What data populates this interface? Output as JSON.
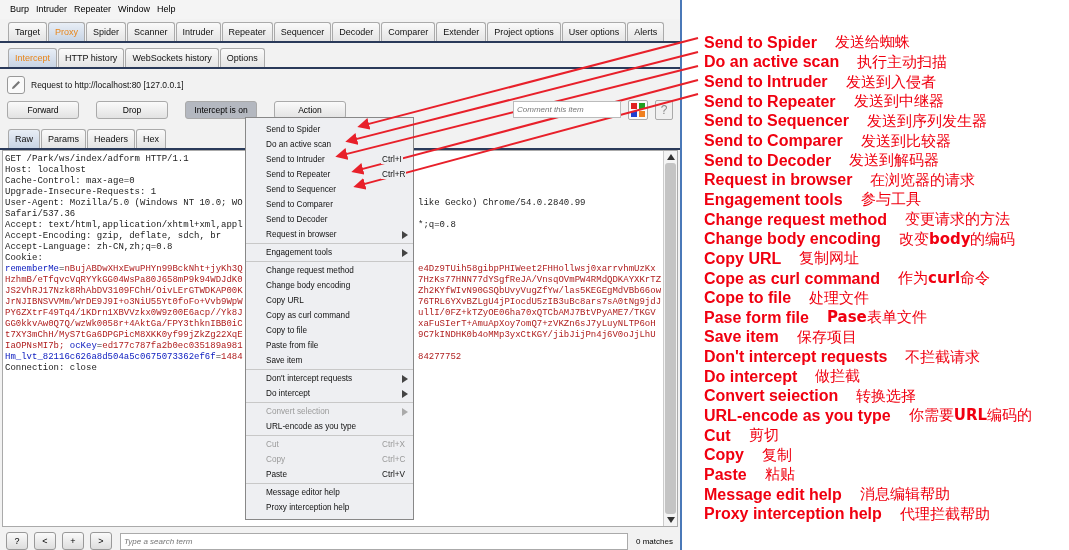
{
  "menu_bar": [
    "Burp",
    "Intruder",
    "Repeater",
    "Window",
    "Help"
  ],
  "tabs": [
    {
      "label": "Target",
      "selected": false
    },
    {
      "label": "Proxy",
      "selected": true
    },
    {
      "label": "Spider",
      "selected": false
    },
    {
      "label": "Scanner",
      "selected": false
    },
    {
      "label": "Intruder",
      "selected": false
    },
    {
      "label": "Repeater",
      "selected": false
    },
    {
      "label": "Sequencer",
      "selected": false
    },
    {
      "label": "Decoder",
      "selected": false
    },
    {
      "label": "Comparer",
      "selected": false
    },
    {
      "label": "Extender",
      "selected": false
    },
    {
      "label": "Project options",
      "selected": false
    },
    {
      "label": "User options",
      "selected": false
    },
    {
      "label": "Alerts",
      "selected": false
    }
  ],
  "sub_tabs": [
    {
      "label": "Intercept",
      "selected": true
    },
    {
      "label": "HTTP history",
      "selected": false
    },
    {
      "label": "WebSockets history",
      "selected": false
    },
    {
      "label": "Options",
      "selected": false
    }
  ],
  "request_info": "Request to http://localhost:80  [127.0.0.1]",
  "buttons": [
    {
      "label": "Forward",
      "pressed": false
    },
    {
      "label": "Drop",
      "pressed": false
    },
    {
      "label": "Intercept is on",
      "pressed": true
    },
    {
      "label": "Action",
      "pressed": false
    }
  ],
  "comment": {
    "placeholder": "Comment this item"
  },
  "help_button": "?",
  "editor_tabs": [
    {
      "label": "Raw",
      "selected": true
    },
    {
      "label": "Params",
      "selected": false
    },
    {
      "label": "Headers",
      "selected": false
    },
    {
      "label": "Hex",
      "selected": false
    }
  ],
  "request_lines": [
    {
      "left": [
        {
          "text": "GET /Park/ws/index/adform HTTP/1.1",
          "kind": "plain"
        }
      ]
    },
    {
      "left": [
        {
          "text": "Host: localhost",
          "kind": "plain"
        }
      ]
    },
    {
      "left": [
        {
          "text": "Cache-Control: max-age=0",
          "kind": "plain"
        }
      ]
    },
    {
      "left": [
        {
          "text": "Upgrade-Insecure-Requests: 1",
          "kind": "plain"
        }
      ]
    },
    {
      "left": [
        {
          "text": "User-Agent: Mozilla/5.0 (Windows NT 10.0; WO",
          "kind": "plain"
        }
      ],
      "right": [
        {
          "text": "like Gecko) Chrome/54.0.2840.99",
          "kind": "plain"
        }
      ]
    },
    {
      "left": [
        {
          "text": "Safari/537.36",
          "kind": "plain"
        }
      ]
    },
    {
      "left": [
        {
          "text": "Accept: text/html,application/xhtml+xml,appl",
          "kind": "plain"
        }
      ],
      "right": [
        {
          "text": "*;q=0.8",
          "kind": "plain"
        }
      ]
    },
    {
      "left": [
        {
          "text": "Accept-Encoding: gzip, deflate, sdch, br",
          "kind": "plain"
        }
      ]
    },
    {
      "left": [
        {
          "text": "Accept-Language: zh-CN,zh;q=0.8",
          "kind": "plain"
        }
      ]
    },
    {
      "left": [
        {
          "text": "Cookie:",
          "kind": "plain"
        }
      ]
    },
    {
      "left": [
        {
          "text": "rememberMe",
          "kind": "name"
        },
        {
          "text": "=",
          "kind": "plain"
        },
        {
          "text": "nBujABDwXHxEwuPHYn99BckNht+jyKh3Q",
          "kind": "value"
        }
      ],
      "right": [
        {
          "text": "e4Dz9TUih58gibpPHIWeet2FHHollwsj0xarrvhmUzKx",
          "kind": "value"
        }
      ]
    },
    {
      "left": [
        {
          "text": "HzhmB/eTfqvcVqRYYkGG04WsPa80J658mP9k94WDJdK0",
          "kind": "value"
        }
      ],
      "right": [
        {
          "text": "7HzKs77HNN77dYSgfReJA/VnsqOVmPW4RMdQDKAYXKrTZ",
          "kind": "value"
        }
      ]
    },
    {
      "left": [
        {
          "text": "JS2VhRJ17Nzk8RhAbDV3109FChH/OivLErGTWDKAP00K",
          "kind": "value"
        }
      ],
      "right": [
        {
          "text": "Zh2KYfWIvN90GSQbUvyVugZfYw/las5KEGEgMdVBb66ow",
          "kind": "value"
        }
      ]
    },
    {
      "left": [
        {
          "text": "JrNJIBNSVVMm/WrDE9J9I+o3NiU55Yt0foFo+Vvb9WpW",
          "kind": "value"
        }
      ],
      "right": [
        {
          "text": "76TRL6YXvBZLgU4jPIocdU5zIB3uBc8ars7sA0tNg9jdJ",
          "kind": "value"
        }
      ]
    },
    {
      "left": [
        {
          "text": "PY6ZXtrF49Tq4/1KDrn1XBVVzkx0W9z00E6acp//Yk8J",
          "kind": "value"
        }
      ],
      "right": [
        {
          "text": "ullI/0FZ+kTZyOE06ha70xQTCbAMJ7BtVPyAME7/TKGV",
          "kind": "value"
        }
      ]
    },
    {
      "left": [
        {
          "text": "GG0kkvAw0Q7Q/wzWk0058r+4AktGa/FPY3thknIBB0iC",
          "kind": "value"
        }
      ],
      "right": [
        {
          "text": "xaFuSIerT+AmuApXoy7omQ7+zVKZn6sJ7yLuyNLTP6oH",
          "kind": "value"
        }
      ]
    },
    {
      "left": [
        {
          "text": "t7XY3mChH/MyS7tGa6DPGPicM8XKK0yf99jZkZg22XqE",
          "kind": "value"
        }
      ],
      "right": [
        {
          "text": "9C7kINDHK0b4oMMp3yxCtKGY/jibJijPn4j6V0oJjLhU",
          "kind": "value"
        }
      ]
    },
    {
      "left": [
        {
          "text": "IaOPNsMI7b; ",
          "kind": "value"
        },
        {
          "text": "ocKey",
          "kind": "name"
        },
        {
          "text": "=",
          "kind": "plain"
        },
        {
          "text": "ed177c787fa2b0ec035189a981",
          "kind": "value"
        }
      ]
    },
    {
      "left": [
        {
          "text": "Hm_lvt_82116c626a8d504a5c0675073362ef6f",
          "kind": "name"
        },
        {
          "text": "=",
          "kind": "plain"
        },
        {
          "text": "1484",
          "kind": "value"
        }
      ],
      "right": [
        {
          "text": "84277752",
          "kind": "value"
        }
      ]
    },
    {
      "left": [
        {
          "text": "Connection: close",
          "kind": "plain"
        }
      ]
    }
  ],
  "context_menu": [
    [
      {
        "label": "Send to Spider",
        "submenu": false,
        "disabled": false
      },
      {
        "label": "Do an active scan",
        "submenu": false,
        "disabled": false
      },
      {
        "label": "Send to Intruder",
        "shortcut": "Ctrl+I",
        "submenu": false,
        "disabled": false
      },
      {
        "label": "Send to Repeater",
        "shortcut": "Ctrl+R",
        "submenu": false,
        "disabled": false
      },
      {
        "label": "Send to Sequencer",
        "submenu": false,
        "disabled": false
      },
      {
        "label": "Send to Comparer",
        "submenu": false,
        "disabled": false
      },
      {
        "label": "Send to Decoder",
        "submenu": false,
        "disabled": false
      },
      {
        "label": "Request in browser",
        "submenu": true,
        "disabled": false
      }
    ],
    [
      {
        "label": "Engagement tools",
        "submenu": true,
        "disabled": false
      }
    ],
    [
      {
        "label": "Change request method",
        "submenu": false,
        "disabled": false
      },
      {
        "label": "Change body encoding",
        "submenu": false,
        "disabled": false
      },
      {
        "label": "Copy URL",
        "submenu": false,
        "disabled": false
      },
      {
        "label": "Copy as curl command",
        "submenu": false,
        "disabled": false
      },
      {
        "label": "Copy to file",
        "submenu": false,
        "disabled": false
      },
      {
        "label": "Paste from file",
        "submenu": false,
        "disabled": false
      },
      {
        "label": "Save item",
        "submenu": false,
        "disabled": false
      }
    ],
    [
      {
        "label": "Don't intercept requests",
        "submenu": true,
        "disabled": false
      },
      {
        "label": "Do intercept",
        "submenu": true,
        "disabled": false
      }
    ],
    [
      {
        "label": "Convert selection",
        "submenu": true,
        "disabled": true
      },
      {
        "label": "URL-encode as you type",
        "submenu": false,
        "disabled": false
      }
    ],
    [
      {
        "label": "Cut",
        "shortcut": "Ctrl+X",
        "submenu": false,
        "disabled": true
      },
      {
        "label": "Copy",
        "shortcut": "Ctrl+C",
        "submenu": false,
        "disabled": true
      },
      {
        "label": "Paste",
        "shortcut": "Ctrl+V",
        "submenu": false,
        "disabled": false
      }
    ],
    [
      {
        "label": "Message editor help",
        "submenu": false,
        "disabled": false
      },
      {
        "label": "Proxy interception help",
        "submenu": false,
        "disabled": false
      }
    ]
  ],
  "search_bar": {
    "buttons": [
      "?",
      "<",
      "+",
      ">"
    ],
    "placeholder": "Type a search term",
    "matches": "0 matches"
  },
  "annotations": [
    {
      "english": "Send to Spider",
      "chinese": "发送给蜘蛛"
    },
    {
      "english": "Do an active scan",
      "chinese": "执行主动扫描"
    },
    {
      "english": "Send to Intruder",
      "chinese": "发送到入侵者"
    },
    {
      "english": "Send to Repeater",
      "chinese": "发送到中继器"
    },
    {
      "english": "Send to Sequencer",
      "chinese": "发送到序列发生器"
    },
    {
      "english": "Send to Comparer",
      "chinese": "发送到比较器"
    },
    {
      "english": "Send to Decoder",
      "chinese": "发送到解码器"
    },
    {
      "english": "Request in browser",
      "chinese": "在浏览器的请求"
    },
    {
      "english": "Engagement tools",
      "chinese": "参与工具"
    },
    {
      "english": "Change request method",
      "chinese": "变更请求的方法"
    },
    {
      "english": "Change body encoding",
      "chinese": "改变**body**的编码"
    },
    {
      "english": "Copy URL",
      "chinese": "复制网址"
    },
    {
      "english": "Cope as curl command",
      "chinese": "作为**curl**命令"
    },
    {
      "english": "Cope to file",
      "chinese": "处理文件"
    },
    {
      "english": "Pase form file",
      "chinese": "**Pase**表单文件"
    },
    {
      "english": "Save item",
      "chinese": "保存项目"
    },
    {
      "english": "Don't intercept requests",
      "chinese": "不拦截请求"
    },
    {
      "english": "Do intercept",
      "chinese": "做拦截"
    },
    {
      "english": "Convert seiection",
      "chinese": "转换选择"
    },
    {
      "english": "URL-encode as you type",
      "chinese": "你需要**URL**编码的"
    },
    {
      "english": "Cut",
      "chinese": "剪切"
    },
    {
      "english": "Copy",
      "chinese": "复制"
    },
    {
      "english": "Paste",
      "chinese": "粘贴"
    },
    {
      "english": "Message edit help",
      "chinese": "消息编辑帮助"
    },
    {
      "english": "Proxy interception help",
      "chinese": "代理拦截帮助"
    }
  ]
}
